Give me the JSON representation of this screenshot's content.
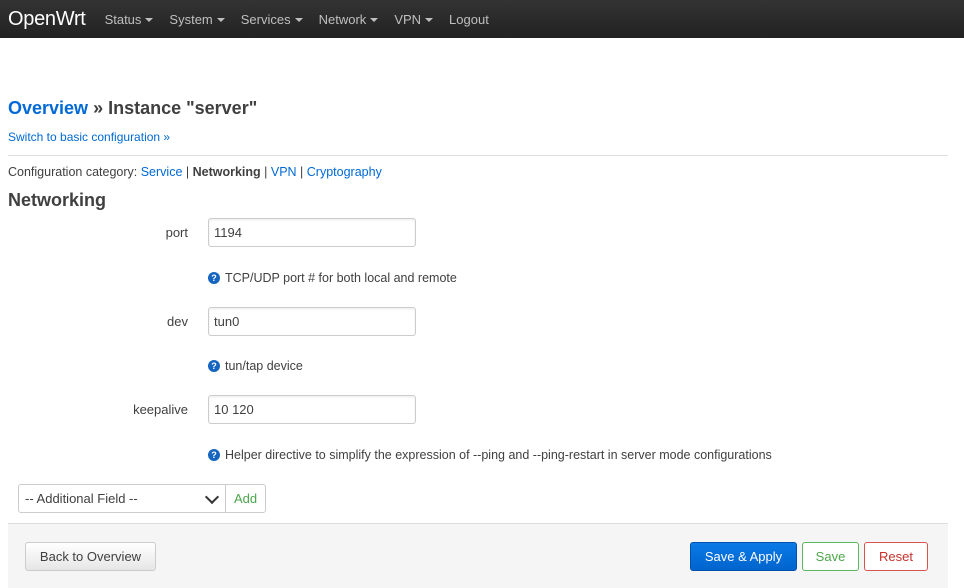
{
  "nav": {
    "brand": "OpenWrt",
    "menu": [
      {
        "label": "Status",
        "dropdown": true
      },
      {
        "label": "System",
        "dropdown": true
      },
      {
        "label": "Services",
        "dropdown": true
      },
      {
        "label": "Network",
        "dropdown": true
      },
      {
        "label": "VPN",
        "dropdown": true
      },
      {
        "label": "Logout",
        "dropdown": false
      }
    ]
  },
  "page": {
    "breadcrumb": "Overview",
    "separator": " » ",
    "title": "Instance \"server\"",
    "switch_link": "Switch to basic configuration »",
    "category_prefix": "Configuration category: ",
    "categories": [
      "Service",
      "Networking",
      "VPN",
      "Cryptography"
    ],
    "active_category": "Networking",
    "section_title": "Networking"
  },
  "fields": [
    {
      "label": "port",
      "value": "1194",
      "help": "TCP/UDP port # for both local and remote"
    },
    {
      "label": "dev",
      "value": "tun0",
      "help": "tun/tap device"
    },
    {
      "label": "keepalive",
      "value": "10 120",
      "help": "Helper directive to simplify the expression of --ping and --ping-restart in server mode configurations"
    }
  ],
  "additional": {
    "select_value": "-- Additional Field --",
    "add_label": "Add"
  },
  "footer": {
    "back_label": "Back to Overview",
    "apply_label": "Save & Apply",
    "save_label": "Save",
    "reset_label": "Reset"
  },
  "icons": {
    "help": "help-icon",
    "dropdown": "caret-down-icon",
    "select": "chevron-down-icon"
  },
  "colors": {
    "link": "#0069d6",
    "topbar": "#2b2b2b",
    "help_icon": "#1565c0",
    "save_green": "#4ca64c",
    "reset_red": "#c9302c"
  }
}
